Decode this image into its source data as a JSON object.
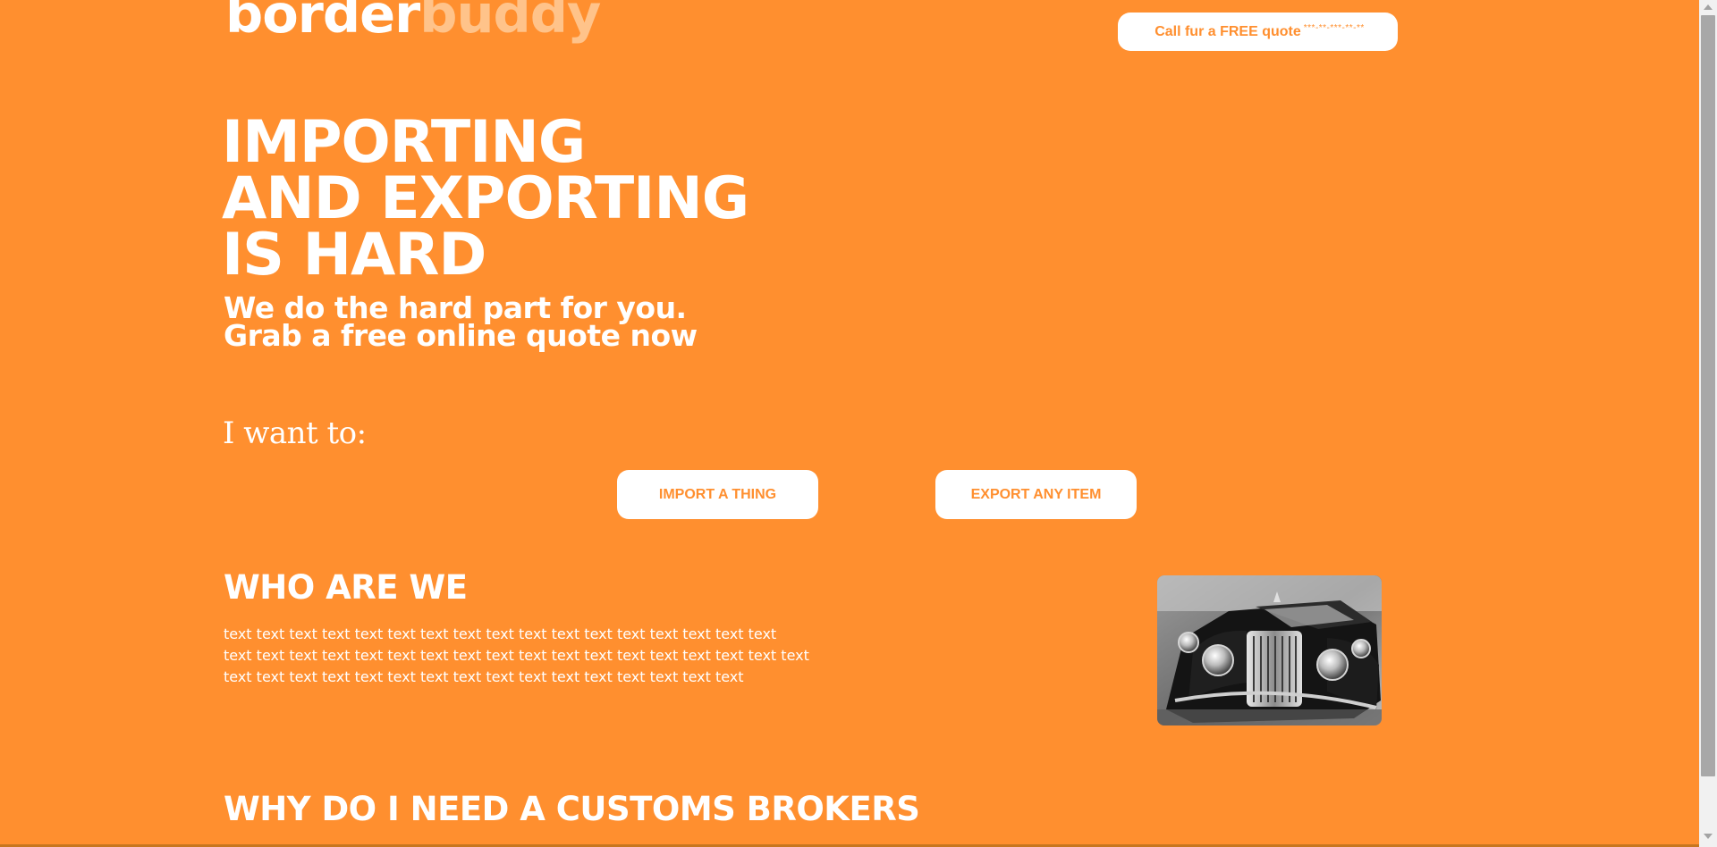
{
  "header": {
    "logo": {
      "part1": "border",
      "part2": "buddy"
    },
    "quote_button": {
      "label": "Call fur a FREE quote",
      "number": "***-**-***-**-**"
    }
  },
  "hero": {
    "title_lines": [
      "IMPORTING",
      "AND EXPORTING",
      "IS HARD"
    ],
    "subtitle_lines": [
      "We do the hard part for you.",
      "Grab a free online quote now"
    ]
  },
  "choice": {
    "prompt": "I want to:",
    "import_label": "IMPORT A THING",
    "export_label": "EXPORT ANY ITEM"
  },
  "who": {
    "title": "WHO ARE WE",
    "text_lines": [
      "text text text text text text text text text text text text text text text text text",
      "text text text text text text text text text text text text text text text text text text",
      "text text text text text text text text text text text text text text text text"
    ]
  },
  "why": {
    "title": "WHY DO I NEED A CUSTOMS BROKERS"
  },
  "colors": {
    "background": "#ff8f2f",
    "accent_text": "#ff8f2f",
    "logo_light": "#ffc38a",
    "white": "#ffffff"
  }
}
